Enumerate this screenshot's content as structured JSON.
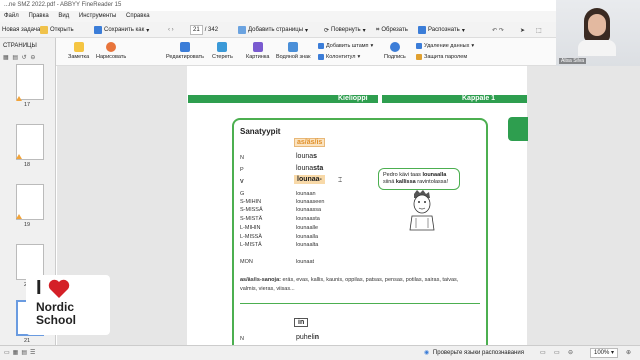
{
  "window": {
    "title": "...ne SMZ 2022.pdf - ABBYY FineReader 15"
  },
  "menu": [
    "Файл",
    "Правка",
    "Вид",
    "Инструменты",
    "Справка"
  ],
  "toolbar1": {
    "new_task": "Новая задача",
    "open": "Открыть",
    "save_as": "Сохранить как",
    "page_current": "21",
    "page_total": "/ 342",
    "add_pages": "Добавить страницы",
    "rotate": "Повернуть",
    "crop": "Обрезать",
    "recognize": "Распознать"
  },
  "toolbar2": {
    "note": "Заметка",
    "draw": "Нарисовать",
    "edit": "Редактировать",
    "erase": "Стереть",
    "image": "Картинка",
    "watermark": "Водяной знак",
    "add_stamp": "Добавить штамп",
    "header_footer": "Колонтитул",
    "sign": "Подпись",
    "delete_data": "Удаление данных",
    "password": "Защита паролем"
  },
  "sidebar": {
    "title": "СТРАНИЦЫ",
    "pages": [
      "17",
      "18",
      "19",
      "20",
      "21"
    ]
  },
  "webcam": {
    "name": "Alisa Silva"
  },
  "document": {
    "band_left": "Kielioppi",
    "band_right": "Kappale 1",
    "heading": "Sanatyypit",
    "type_tag": "as/äs/is",
    "rows_top": [
      {
        "case": "N",
        "stem": "louna",
        "end": "s"
      },
      {
        "case": "P",
        "stem": "louna",
        "end": "sta"
      },
      {
        "case": "V",
        "stem": "lounaa-",
        "end": ""
      }
    ],
    "rows": [
      {
        "case": "G",
        "form": "lounaan"
      },
      {
        "case": "S-MIHIN",
        "form": "lounaaseen"
      },
      {
        "case": "S-MISSÄ",
        "form": "lounaassa"
      },
      {
        "case": "S-MISTÄ",
        "form": "lounaasta"
      },
      {
        "case": "L-MIHIN",
        "form": "lounaalle"
      },
      {
        "case": "L-MISSÄ",
        "form": "lounaalla"
      },
      {
        "case": "L-MISTÄ",
        "form": "lounaalta"
      }
    ],
    "mon": {
      "case": "MON",
      "form": "lounaat"
    },
    "speech_part1": "Pedro kävi taas ",
    "speech_bold1": "lounaalla",
    "speech_part2": "siinä ",
    "speech_bold2": "kallissa",
    "speech_part3": " ravintolassa!",
    "words_label": "as/äs/is-sanoja:",
    "words_line1": " eräs, evas, kallis, kaunis, oppilas, patsas, pensas, potilas, sairas, taivas,",
    "words_line2": "valmis, vieras, viisas...",
    "tag2": "in",
    "row_bottom": {
      "case": "N",
      "stem": "puheli",
      "end": "n"
    }
  },
  "logo": {
    "line1": "I",
    "line2": "Nordic",
    "line3": "School"
  },
  "statusbar": {
    "check_languages": "Проверьте языки распознавания",
    "zoom": "100%"
  },
  "colors": {
    "green": "#2e9e4f",
    "orange": "#f2a43a",
    "tag_bg": "#f8d9a8",
    "logo_red": "#d42027"
  }
}
